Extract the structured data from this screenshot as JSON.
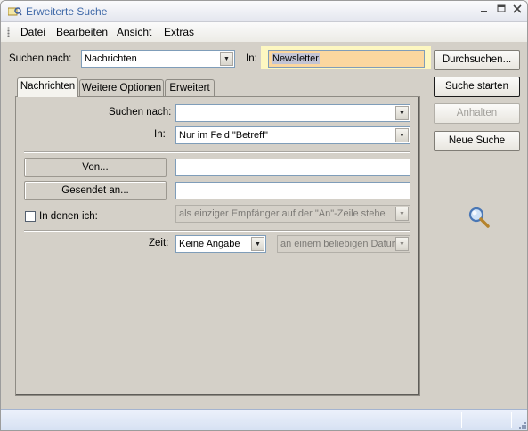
{
  "window": {
    "title": "Erweiterte Suche"
  },
  "menu": {
    "items": [
      {
        "label": "Datei"
      },
      {
        "label": "Bearbeiten"
      },
      {
        "label": "Ansicht"
      },
      {
        "label": "Extras"
      }
    ]
  },
  "search": {
    "suchen_nach_label": "Suchen nach:",
    "suchen_nach_value": "Nachrichten",
    "in_label": "In:",
    "in_value": "Newsletter"
  },
  "side_buttons": {
    "durchsuchen": "Durchsuchen...",
    "suche_starten": "Suche starten",
    "anhalten": "Anhalten",
    "neue_suche": "Neue Suche"
  },
  "tabs": [
    {
      "label": "Nachrichten",
      "active": true
    },
    {
      "label": "Weitere Optionen",
      "active": false
    },
    {
      "label": "Erweitert",
      "active": false
    }
  ],
  "form": {
    "suchen_nach_label": "Suchen nach:",
    "suchen_nach_value": "",
    "in_label": "In:",
    "in_value": "Nur im Feld \"Betreff\"",
    "von_button": "Von...",
    "von_value": "",
    "gesendet_an_button": "Gesendet an...",
    "gesendet_an_value": "",
    "in_denen_ich_label": "In denen ich:",
    "in_denen_ich_checked": false,
    "in_denen_ich_value": "als einziger Empfänger auf der \"An\"-Zeile stehe",
    "zeit_label": "Zeit:",
    "zeit_value": "Keine Angabe",
    "datum_value": "an einem beliebigen Datum"
  },
  "colors": {
    "title_text": "#3f69a8",
    "in_field_bg": "#fbd79f",
    "in_highlight_bg": "#fdf7c1",
    "status_bar": "#dde6f4"
  }
}
